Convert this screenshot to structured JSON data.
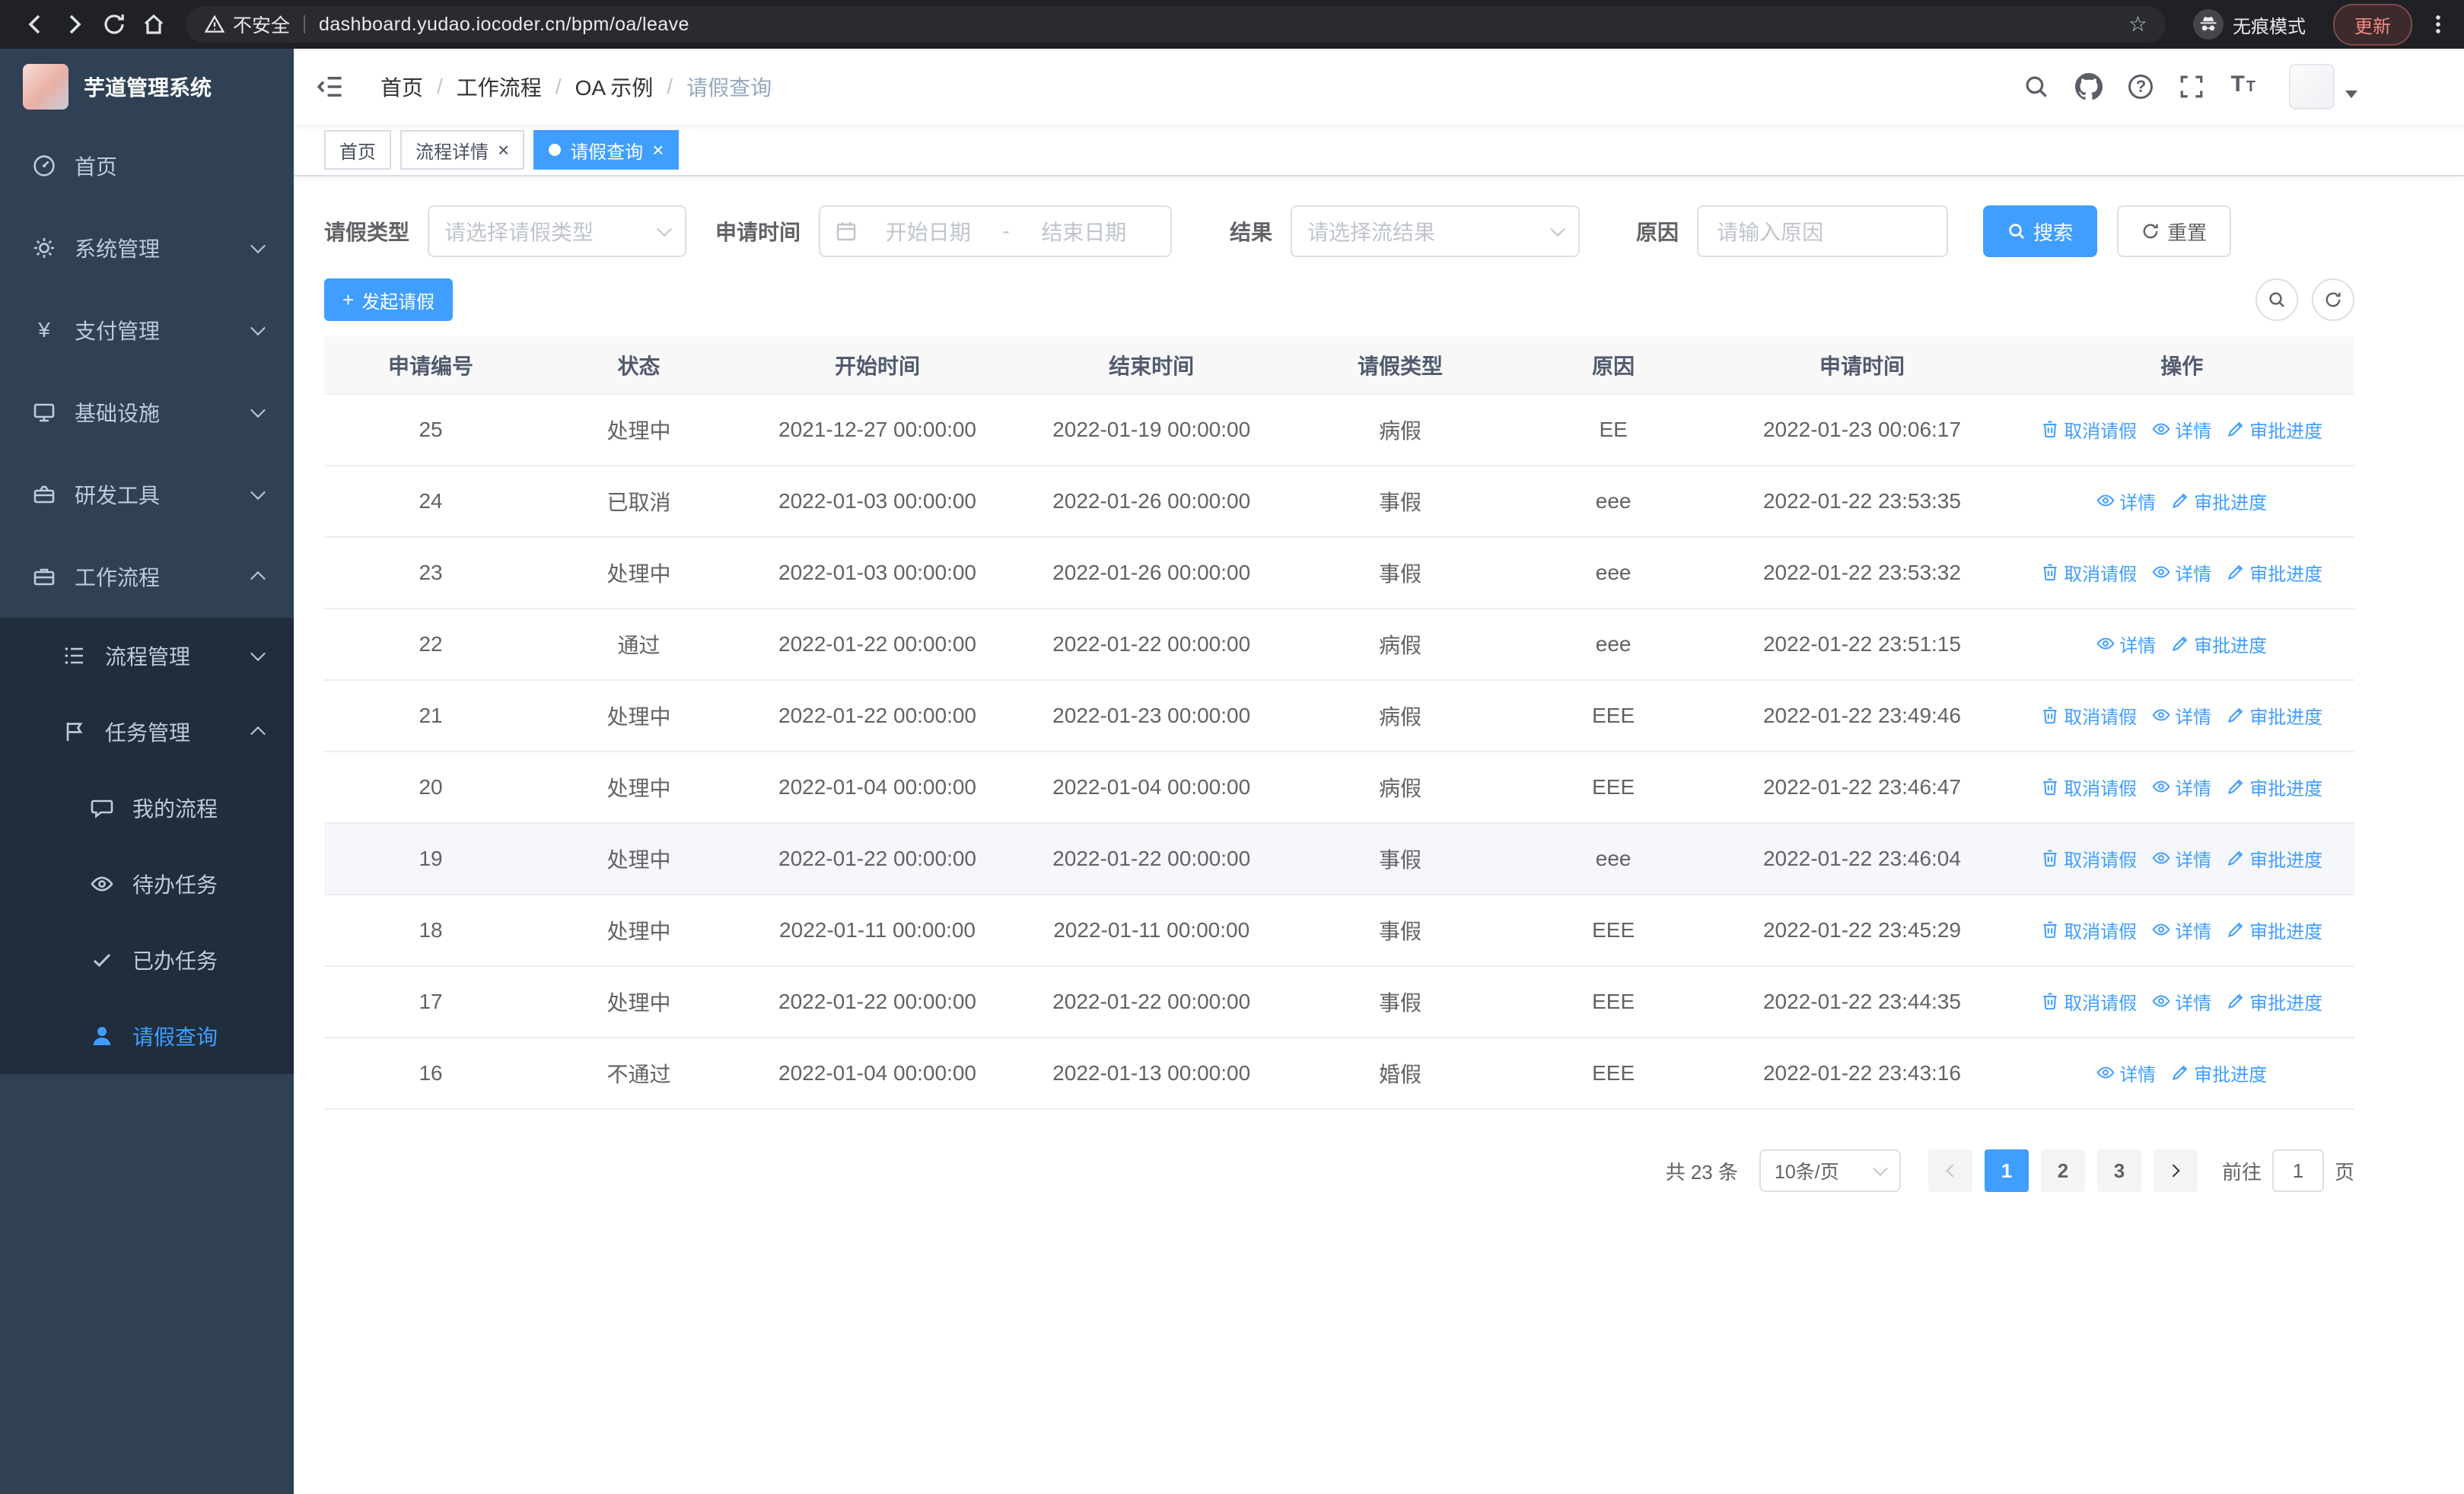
{
  "browser": {
    "security_label": "不安全",
    "url": "dashboard.yudao.iocoder.cn/bpm/oa/leave",
    "incognito_label": "无痕模式",
    "update_label": "更新"
  },
  "icons": {
    "star": "☆",
    "yen": "¥",
    "question": "?",
    "font_large": "T",
    "font_small": "T",
    "plus": "+"
  },
  "sidebar": {
    "title": "芋道管理系统",
    "menu": [
      {
        "label": "首页"
      },
      {
        "label": "系统管理"
      },
      {
        "label": "支付管理"
      },
      {
        "label": "基础设施"
      },
      {
        "label": "研发工具"
      },
      {
        "label": "工作流程"
      }
    ],
    "workflow_submenu": [
      {
        "label": "流程管理"
      },
      {
        "label": "任务管理"
      }
    ],
    "task_submenu": [
      {
        "label": "我的流程"
      },
      {
        "label": "待办任务"
      },
      {
        "label": "已办任务"
      },
      {
        "label": "请假查询"
      }
    ]
  },
  "header": {
    "breadcrumb": [
      "首页",
      "工作流程",
      "OA 示例",
      "请假查询"
    ],
    "breadcrumb_separator": "/"
  },
  "tabs": [
    {
      "label": "首页",
      "closable": false,
      "active": false
    },
    {
      "label": "流程详情",
      "closable": true,
      "active": false
    },
    {
      "label": "请假查询",
      "closable": true,
      "active": true
    }
  ],
  "filters": {
    "leave_type_label": "请假类型",
    "leave_type_placeholder": "请选择请假类型",
    "apply_time_label": "申请时间",
    "start_date_placeholder": "开始日期",
    "date_separator": "-",
    "end_date_placeholder": "结束日期",
    "result_label": "结果",
    "result_placeholder": "请选择流结果",
    "reason_label": "原因",
    "reason_placeholder": "请输入原因",
    "search_button": "搜索",
    "reset_button": "重置"
  },
  "toolbar": {
    "create_button": "发起请假"
  },
  "table": {
    "columns": [
      "申请编号",
      "状态",
      "开始时间",
      "结束时间",
      "请假类型",
      "原因",
      "申请时间",
      "操作"
    ],
    "actions": {
      "cancel": "取消请假",
      "detail": "详情",
      "progress": "审批进度"
    },
    "rows": [
      {
        "id": "25",
        "status": "处理中",
        "start": "2021-12-27 00:00:00",
        "end": "2022-01-19 00:00:00",
        "type": "病假",
        "reason": "EE",
        "applied": "2022-01-23 00:06:17",
        "cancellable": true,
        "hover": false
      },
      {
        "id": "24",
        "status": "已取消",
        "start": "2022-01-03 00:00:00",
        "end": "2022-01-26 00:00:00",
        "type": "事假",
        "reason": "eee",
        "applied": "2022-01-22 23:53:35",
        "cancellable": false,
        "hover": false
      },
      {
        "id": "23",
        "status": "处理中",
        "start": "2022-01-03 00:00:00",
        "end": "2022-01-26 00:00:00",
        "type": "事假",
        "reason": "eee",
        "applied": "2022-01-22 23:53:32",
        "cancellable": true,
        "hover": false
      },
      {
        "id": "22",
        "status": "通过",
        "start": "2022-01-22 00:00:00",
        "end": "2022-01-22 00:00:00",
        "type": "病假",
        "reason": "eee",
        "applied": "2022-01-22 23:51:15",
        "cancellable": false,
        "hover": false
      },
      {
        "id": "21",
        "status": "处理中",
        "start": "2022-01-22 00:00:00",
        "end": "2022-01-23 00:00:00",
        "type": "病假",
        "reason": "EEE",
        "applied": "2022-01-22 23:49:46",
        "cancellable": true,
        "hover": false
      },
      {
        "id": "20",
        "status": "处理中",
        "start": "2022-01-04 00:00:00",
        "end": "2022-01-04 00:00:00",
        "type": "病假",
        "reason": "EEE",
        "applied": "2022-01-22 23:46:47",
        "cancellable": true,
        "hover": false
      },
      {
        "id": "19",
        "status": "处理中",
        "start": "2022-01-22 00:00:00",
        "end": "2022-01-22 00:00:00",
        "type": "事假",
        "reason": "eee",
        "applied": "2022-01-22 23:46:04",
        "cancellable": true,
        "hover": true
      },
      {
        "id": "18",
        "status": "处理中",
        "start": "2022-01-11 00:00:00",
        "end": "2022-01-11 00:00:00",
        "type": "事假",
        "reason": "EEE",
        "applied": "2022-01-22 23:45:29",
        "cancellable": true,
        "hover": false
      },
      {
        "id": "17",
        "status": "处理中",
        "start": "2022-01-22 00:00:00",
        "end": "2022-01-22 00:00:00",
        "type": "事假",
        "reason": "EEE",
        "applied": "2022-01-22 23:44:35",
        "cancellable": true,
        "hover": false
      },
      {
        "id": "16",
        "status": "不通过",
        "start": "2022-01-04 00:00:00",
        "end": "2022-01-13 00:00:00",
        "type": "婚假",
        "reason": "EEE",
        "applied": "2022-01-22 23:43:16",
        "cancellable": false,
        "hover": false
      }
    ]
  },
  "pagination": {
    "total_text": "共 23 条",
    "page_size": "10条/页",
    "pages": [
      "1",
      "2",
      "3"
    ],
    "active_page": "1",
    "goto_label": "前往",
    "goto_value": "1",
    "goto_suffix": "页"
  },
  "colors": {
    "primary": "#409eff",
    "sidebar_bg": "#304156",
    "submenu_bg": "#1f2d3d",
    "chrome_bg": "#202124"
  }
}
